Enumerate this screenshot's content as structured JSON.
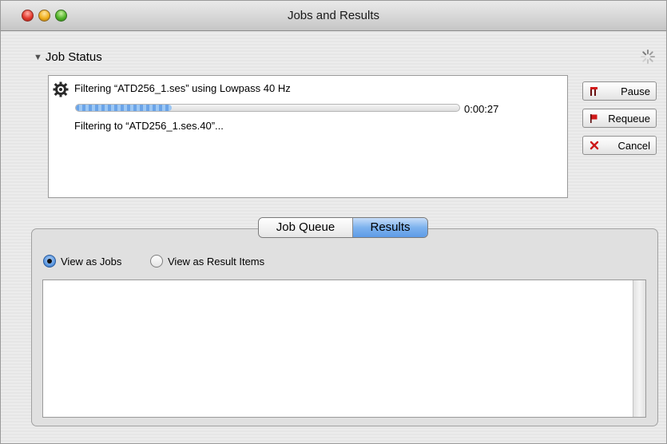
{
  "window": {
    "title": "Jobs and Results"
  },
  "job_status": {
    "section_label": "Job Status",
    "job_line": "Filtering “ATD256_1.ses” using Lowpass 40 Hz",
    "progress_fraction": 0.25,
    "elapsed": "0:00:27",
    "sub_line": "Filtering to “ATD256_1.ses.40”..."
  },
  "actions": {
    "pause": "Pause",
    "requeue": "Requeue",
    "cancel": "Cancel"
  },
  "tabs": {
    "items": [
      "Job Queue",
      "Results"
    ],
    "selected": "Results"
  },
  "view_options": {
    "jobs": "View as Jobs",
    "items": "View as Result Items",
    "selected": "View as Jobs"
  },
  "colors": {
    "accent": "#5e9be6",
    "cancel_red": "#cc1a1a",
    "flag_red": "#d01818"
  }
}
